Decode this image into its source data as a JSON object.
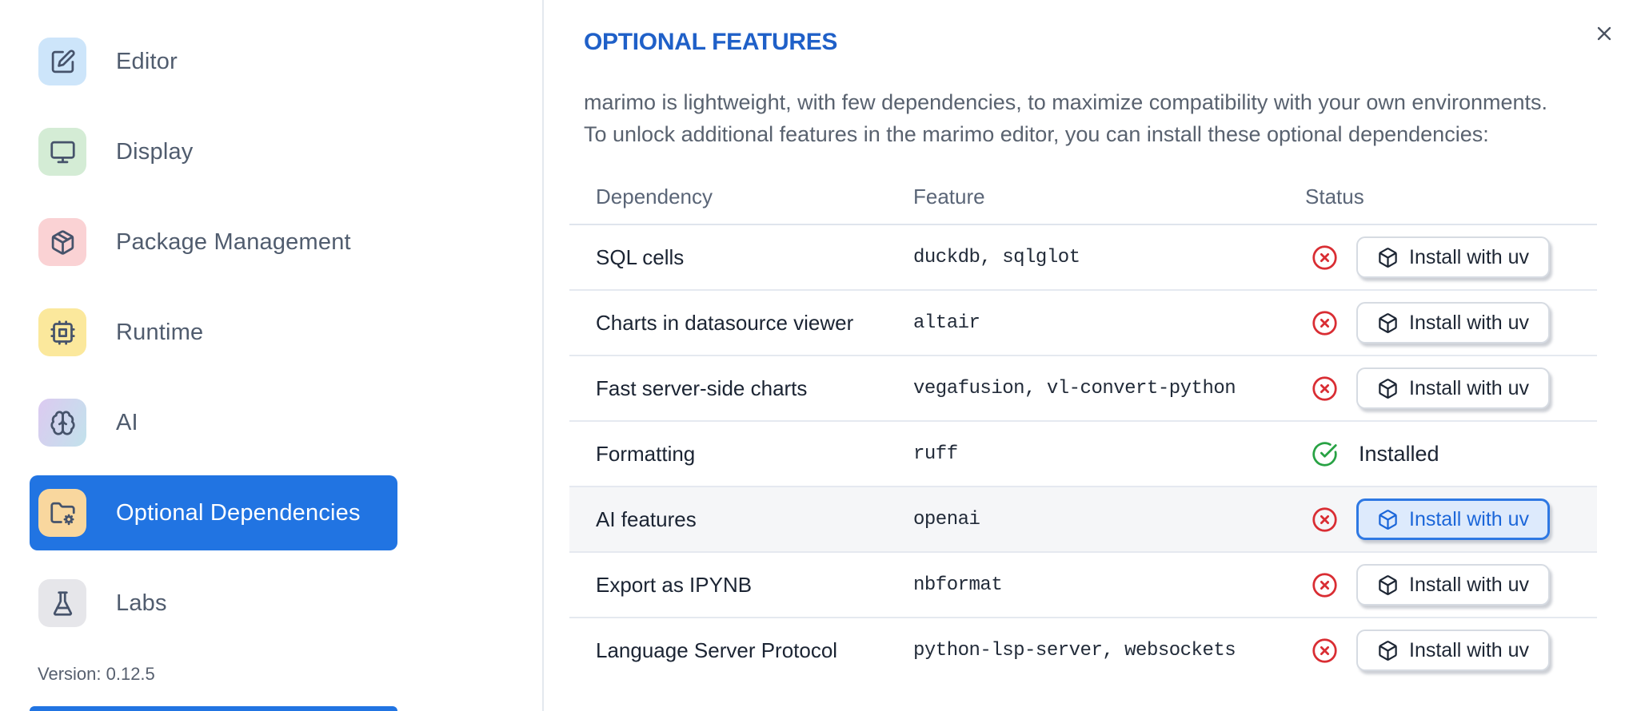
{
  "colors": {
    "accent_blue": "#2174e2",
    "title_blue": "#1f60c8",
    "error_red": "#d92d33",
    "success_green": "#28a244",
    "focus_button_bg": "#ddeafc",
    "focus_button_border": "#2e78e3",
    "focus_button_text": "#1b66d9"
  },
  "sidebar": {
    "items": [
      {
        "label": "Editor",
        "icon": "edit-icon",
        "icon_bg": "#cde5fa",
        "selected": false
      },
      {
        "label": "Display",
        "icon": "monitor-icon",
        "icon_bg": "#d4ecd5",
        "selected": false
      },
      {
        "label": "Package Management",
        "icon": "package-icon",
        "icon_bg": "#fad2d4",
        "selected": false
      },
      {
        "label": "Runtime",
        "icon": "cpu-icon",
        "icon_bg": "#fbe89c",
        "selected": false
      },
      {
        "label": "AI",
        "icon": "brain-icon",
        "icon_bg": "linear-gradient(115deg,#dccaf0 0%,#c2e2ec 100%)",
        "selected": false
      },
      {
        "label": "Optional Dependencies",
        "icon": "folder-gear-icon",
        "icon_bg": "#f9d79e",
        "selected": true
      },
      {
        "label": "Labs",
        "icon": "flask-icon",
        "icon_bg": "#e6e6ea",
        "selected": false
      }
    ],
    "version": "Version: 0.12.5"
  },
  "main": {
    "title": "OPTIONAL FEATURES",
    "description_lines": [
      "marimo is lightweight, with few dependencies, to maximize compatibility with your own environments.",
      "To unlock additional features in the marimo editor, you can install these optional dependencies:"
    ],
    "table": {
      "columns": [
        "Dependency",
        "Feature",
        "Status"
      ],
      "install_button_label": "Install with uv",
      "installed_label": "Installed",
      "rows": [
        {
          "dependency": "SQL cells",
          "feature": "duckdb, sqlglot",
          "status": "not-installed",
          "highlighted": false
        },
        {
          "dependency": "Charts in datasource viewer",
          "feature": "altair",
          "status": "not-installed",
          "highlighted": false
        },
        {
          "dependency": "Fast server-side charts",
          "feature": "vegafusion, vl-convert-python",
          "status": "not-installed",
          "highlighted": false
        },
        {
          "dependency": "Formatting",
          "feature": "ruff",
          "status": "installed",
          "highlighted": false
        },
        {
          "dependency": "AI features",
          "feature": "openai",
          "status": "not-installed",
          "highlighted": true
        },
        {
          "dependency": "Export as IPYNB",
          "feature": "nbformat",
          "status": "not-installed",
          "highlighted": false
        },
        {
          "dependency": "Language Server Protocol",
          "feature": "python-lsp-server, websockets",
          "status": "not-installed",
          "highlighted": false
        }
      ]
    }
  }
}
